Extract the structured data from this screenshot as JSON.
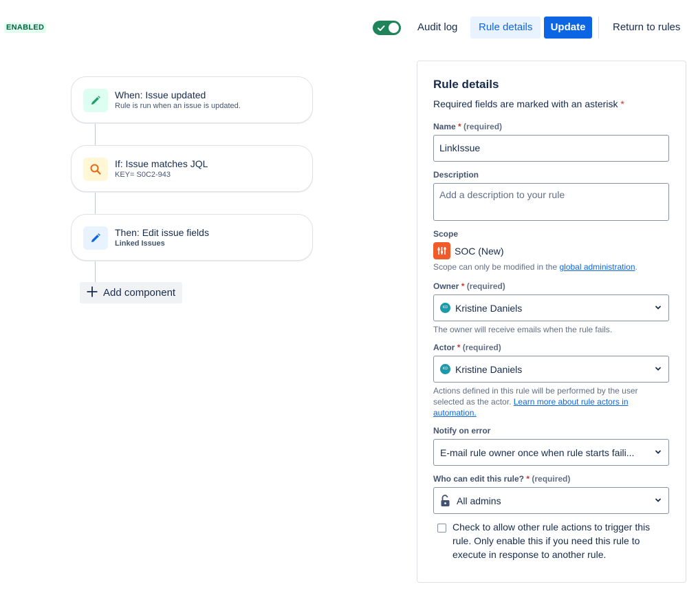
{
  "header": {
    "status_badge": "ENABLED",
    "toggle_on": true,
    "audit_log": "Audit log",
    "rule_details": "Rule details",
    "update": "Update",
    "return_to_rules": "Return to rules"
  },
  "flow": {
    "trigger": {
      "title": "When: Issue updated",
      "subtitle": "Rule is run when an issue is updated.",
      "icon": "pencil-icon",
      "color": "#22a06b"
    },
    "condition": {
      "title": "If: Issue matches JQL",
      "subtitle": "KEY= S0C2-943",
      "icon": "search-icon",
      "color": "#e56910"
    },
    "action": {
      "title": "Then: Edit issue fields",
      "subtitle": "Linked Issues",
      "icon": "pencil-icon",
      "color": "#0c66e4"
    },
    "add_component": "Add component"
  },
  "panel": {
    "title": "Rule details",
    "required_note": "Required fields are marked with an asterisk",
    "asterisk": "*",
    "required_text": "(required)",
    "name": {
      "label": "Name",
      "value": "LinkIssue"
    },
    "description": {
      "label": "Description",
      "placeholder": "Add a description to your rule"
    },
    "scope": {
      "label": "Scope",
      "project": "SOC (New)",
      "help_prefix": "Scope can only be modified in the ",
      "help_link": "global administration",
      "help_suffix": "."
    },
    "owner": {
      "label": "Owner",
      "value": "Kristine Daniels",
      "avatar_initials": "KD",
      "help": "The owner will receive emails when the rule fails."
    },
    "actor": {
      "label": "Actor",
      "value": "Kristine Daniels",
      "avatar_initials": "KD",
      "help_prefix": "Actions defined in this rule will be performed by the user selected as the actor. ",
      "help_link": "Learn more about rule actors in automation."
    },
    "notify": {
      "label": "Notify on error",
      "value": "E-mail rule owner once when rule starts faili..."
    },
    "who_can_edit": {
      "label": "Who can edit this rule?",
      "value": "All admins",
      "icon": "unlock-icon"
    },
    "allow_trigger": {
      "checked": false,
      "text": "Check to allow other rule actions to trigger this rule. Only enable this if you need this rule to execute in response to another rule."
    }
  }
}
